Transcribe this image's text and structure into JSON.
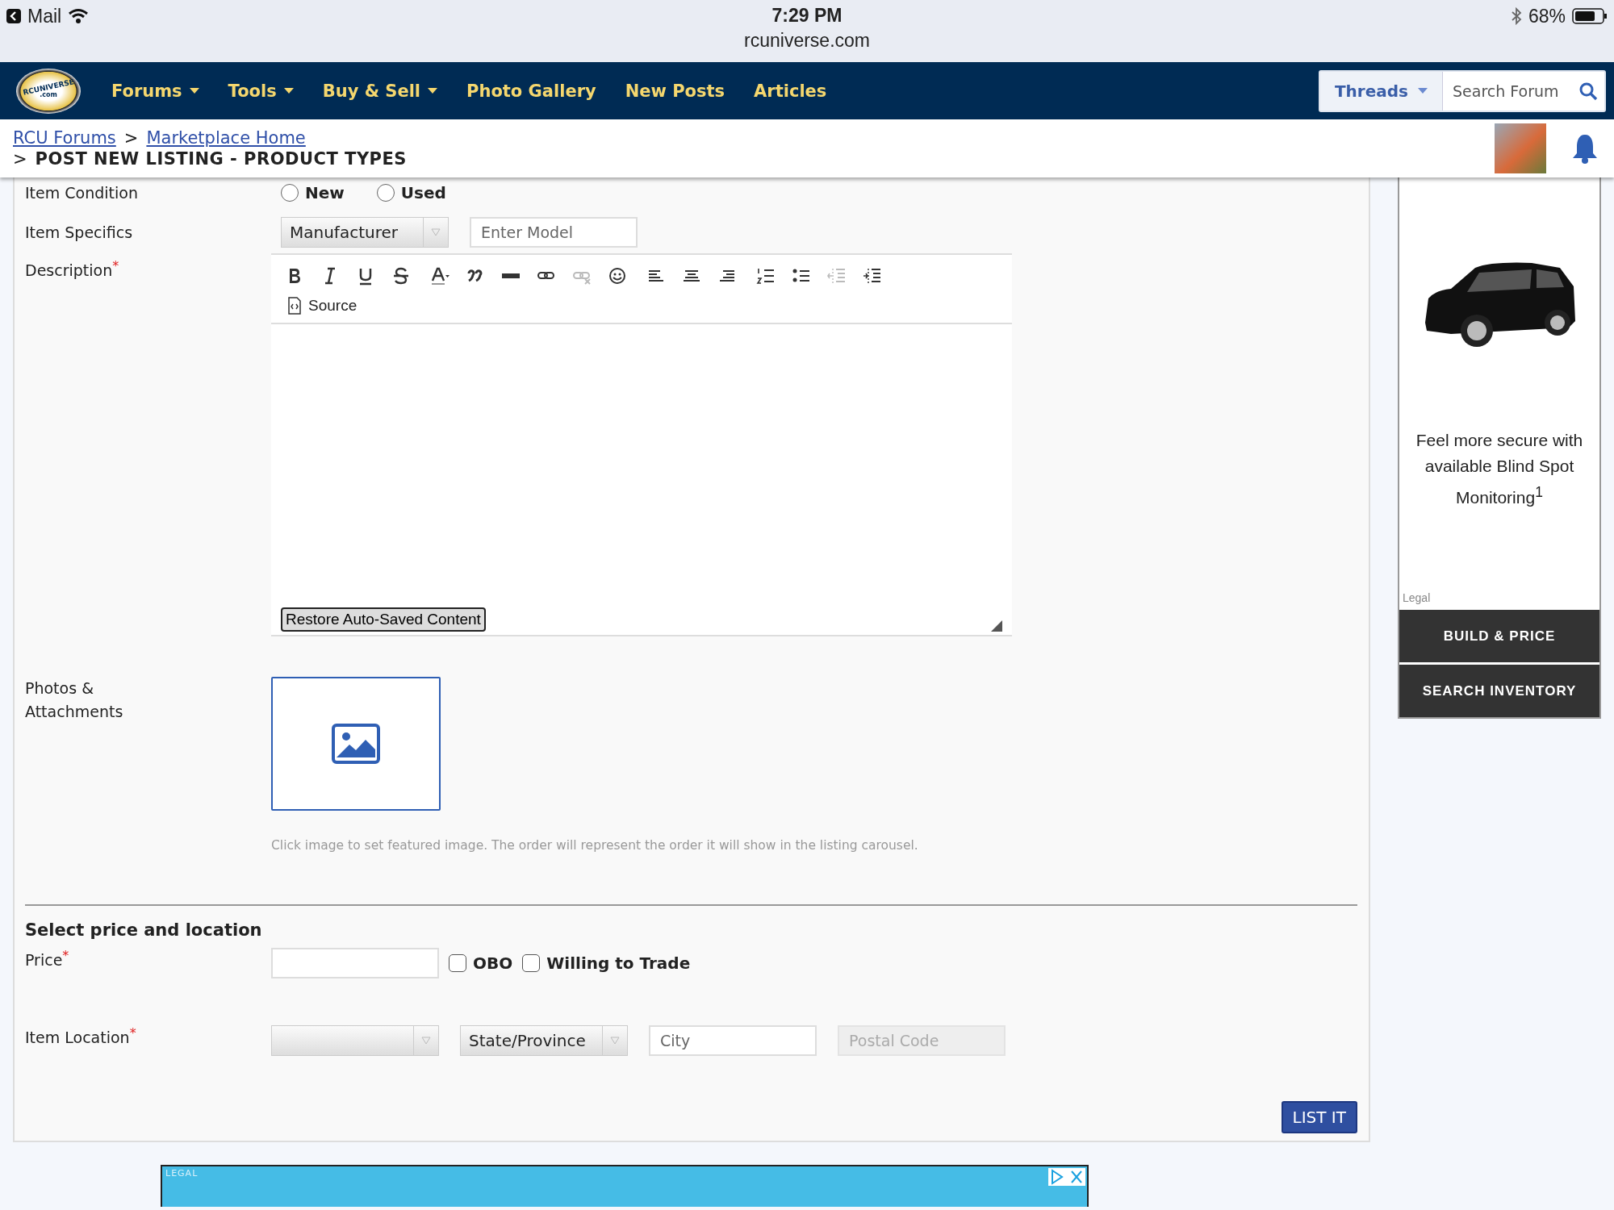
{
  "status_bar": {
    "back_app": "Mail",
    "time": "7:29 PM",
    "url": "rcuniverse.com",
    "battery": "68%"
  },
  "logo": {
    "text": "RCUNIVERSE",
    "sub": ".com"
  },
  "nav": [
    {
      "label": "Forums",
      "has_dropdown": true
    },
    {
      "label": "Tools",
      "has_dropdown": true
    },
    {
      "label": "Buy & Sell",
      "has_dropdown": true
    },
    {
      "label": "Photo Gallery",
      "has_dropdown": false
    },
    {
      "label": "New Posts",
      "has_dropdown": false
    },
    {
      "label": "Articles",
      "has_dropdown": false
    }
  ],
  "search": {
    "scope": "Threads",
    "placeholder": "Search Forum"
  },
  "breadcrumbs": {
    "links": [
      "RCU Forums",
      "Marketplace Home"
    ],
    "separator": ">",
    "current": "POST NEW LISTING - PRODUCT TYPES"
  },
  "form": {
    "condition": {
      "label": "Item Condition",
      "options": [
        {
          "label": "New",
          "selected": false
        },
        {
          "label": "Used",
          "selected": false
        }
      ]
    },
    "specifics": {
      "label": "Item Specifics",
      "manufacturer": "Manufacturer",
      "model_placeholder": "Enter Model"
    },
    "description": {
      "label": "Description",
      "required_mark": "*",
      "toolbar": [
        {
          "kind": "bold",
          "disabled": false
        },
        {
          "kind": "italic",
          "disabled": false
        },
        {
          "kind": "underline",
          "disabled": false
        },
        {
          "kind": "strike",
          "disabled": false
        },
        {
          "kind": "color",
          "disabled": false
        },
        {
          "kind": "quote",
          "disabled": false
        },
        {
          "kind": "rule",
          "disabled": false
        },
        {
          "kind": "link",
          "disabled": false
        },
        {
          "kind": "unlink",
          "disabled": true
        },
        {
          "kind": "smiley",
          "disabled": false
        },
        {
          "kind": "left",
          "disabled": false
        },
        {
          "kind": "center",
          "disabled": false
        },
        {
          "kind": "right",
          "disabled": false
        },
        {
          "kind": "ol",
          "disabled": false
        },
        {
          "kind": "ul",
          "disabled": false
        },
        {
          "kind": "outdent",
          "disabled": true
        },
        {
          "kind": "indent",
          "disabled": false
        }
      ],
      "source": "Source",
      "restore": "Restore Auto-Saved Content"
    },
    "photos": {
      "label": "Photos & Attachments",
      "hint": "Click image to set featured image. The order will represent the order it will show in the listing carousel."
    },
    "section_title": "Select price and location",
    "price": {
      "label": "Price",
      "required_mark": "*",
      "checkboxes": [
        {
          "label": "OBO",
          "checked": false
        },
        {
          "label": "Willing to Trade",
          "checked": false
        }
      ]
    },
    "location": {
      "label": "Item Location",
      "required_mark": "*",
      "state": "State/Province",
      "city_placeholder": "City",
      "postal_placeholder": "Postal Code"
    },
    "submit": "LIST IT"
  },
  "ad": {
    "text": "Feel more secure with available Blind Spot Monitoring$^{1}$",
    "legal": "Legal",
    "buttons": [
      "BUILD & PRICE",
      "SEARCH INVENTORY"
    ]
  },
  "bottom_ad": {
    "legal": "LEGAL"
  }
}
